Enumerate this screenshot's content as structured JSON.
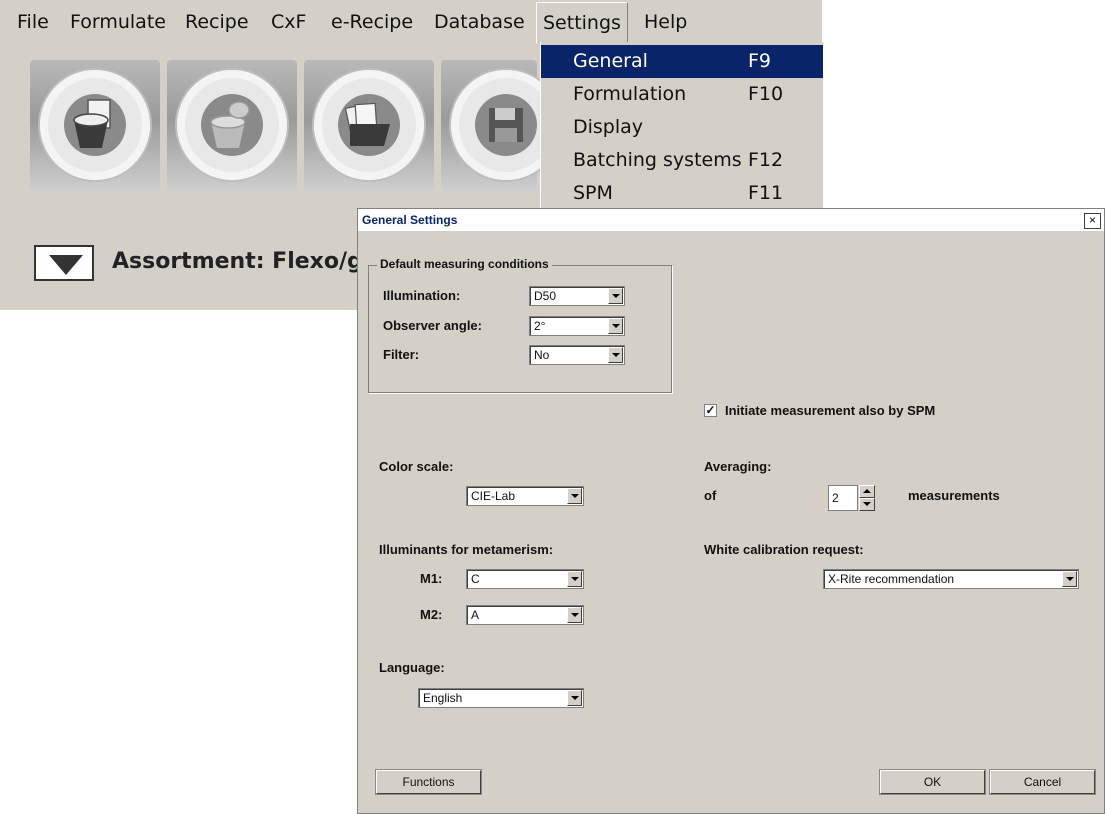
{
  "menubar": {
    "items": [
      "File",
      "Formulate",
      "Recipe",
      "CxF",
      "e-Recipe",
      "Database",
      "Settings",
      "Help"
    ]
  },
  "toolbar": {
    "buttons": [
      {
        "icon": "new-recipe-icon"
      },
      {
        "icon": "open-recipe-icon"
      },
      {
        "icon": "open-folder-icon"
      },
      {
        "icon": "save-icon"
      }
    ]
  },
  "assortment": {
    "label": "Assortment: Flexo/gra"
  },
  "settings_menu": {
    "items": [
      {
        "label": "General",
        "shortcut": "F9",
        "selected": true
      },
      {
        "label": "Formulation",
        "shortcut": "F10"
      },
      {
        "label": "Display",
        "shortcut": ""
      },
      {
        "label": "Batching systems",
        "shortcut": "F12"
      },
      {
        "label": "SPM",
        "shortcut": "F11"
      }
    ]
  },
  "dialog": {
    "title": "General Settings",
    "close": "×",
    "default_measuring": {
      "title": "Default measuring conditions",
      "illumination_label": "Illumination:",
      "illumination_value": "D50",
      "observer_label": "Observer angle:",
      "observer_value": "2°",
      "filter_label": "Filter:",
      "filter_value": "No"
    },
    "initiate_spm": {
      "checked": true,
      "mark": "✓",
      "label": "Initiate measurement also by SPM"
    },
    "color_scale": {
      "label": "Color scale:",
      "value": "CIE-Lab"
    },
    "averaging": {
      "label": "Averaging:",
      "of_label": "of",
      "value": "2",
      "unit_label": "measurements"
    },
    "metamerism": {
      "label": "Illuminants for metamerism:",
      "m1_label": "M1:",
      "m1_value": "C",
      "m2_label": "M2:",
      "m2_value": "A"
    },
    "white_calibration": {
      "label": "White calibration request:",
      "value": "X-Rite recommendation"
    },
    "language": {
      "label": "Language:",
      "value": "English"
    },
    "buttons": {
      "functions": "Functions",
      "ok": "OK",
      "cancel": "Cancel"
    }
  },
  "colors": {
    "face": "#d4d0c8",
    "highlight": "#0a246a"
  }
}
